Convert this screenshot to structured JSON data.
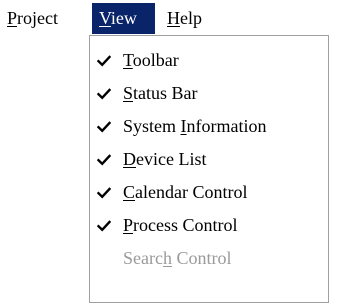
{
  "menubar": {
    "items": [
      {
        "before": "",
        "mnemonic": "P",
        "after": "roject",
        "open": false
      },
      {
        "before": "",
        "mnemonic": "V",
        "after": "iew",
        "open": true
      },
      {
        "before": "",
        "mnemonic": "H",
        "after": "elp",
        "open": false
      }
    ]
  },
  "view_menu": {
    "items": [
      {
        "before": "",
        "mnemonic": "T",
        "after": "oolbar",
        "checked": true,
        "enabled": true
      },
      {
        "before": "",
        "mnemonic": "S",
        "after": "tatus Bar",
        "checked": true,
        "enabled": true
      },
      {
        "before": "System ",
        "mnemonic": "I",
        "after": "nformation",
        "checked": true,
        "enabled": true
      },
      {
        "before": "",
        "mnemonic": "D",
        "after": "evice List",
        "checked": true,
        "enabled": true
      },
      {
        "before": "",
        "mnemonic": "C",
        "after": "alendar Control",
        "checked": true,
        "enabled": true
      },
      {
        "before": "",
        "mnemonic": "P",
        "after": "rocess Control",
        "checked": true,
        "enabled": true
      },
      {
        "before": "Searc",
        "mnemonic": "h",
        "after": " Control",
        "checked": false,
        "enabled": false
      }
    ]
  },
  "colors": {
    "highlight": "#0a246a",
    "disabled_text": "#9a9a9a",
    "check": "#000000"
  },
  "icons": {
    "check": "checkmark-icon"
  }
}
